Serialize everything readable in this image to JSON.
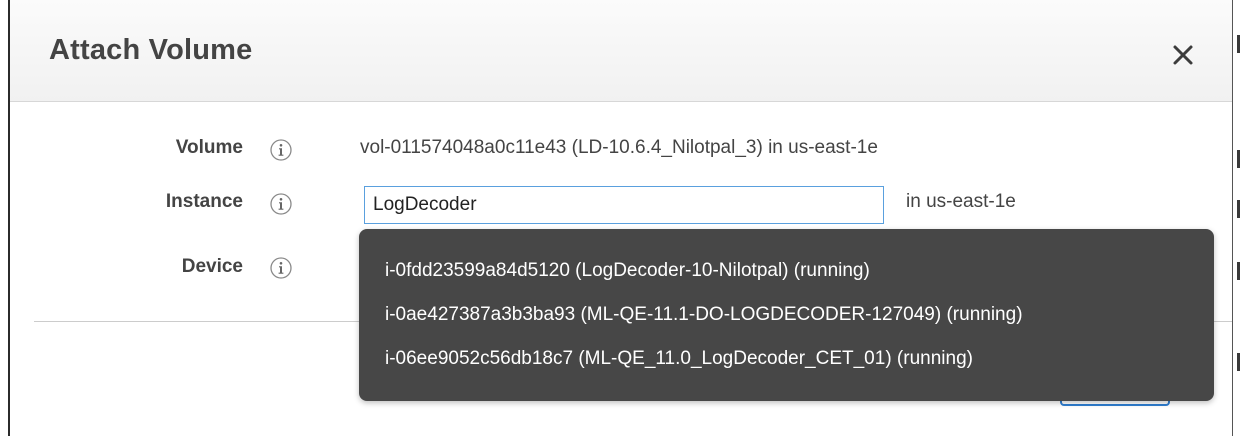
{
  "dialog": {
    "title": "Attach Volume",
    "close_icon": "close-icon"
  },
  "form": {
    "volume": {
      "label": "Volume",
      "info_icon": "info-icon",
      "value": "vol-011574048a0c11e43 (LD-10.6.4_Nilotpal_3) in us-east-1e"
    },
    "instance": {
      "label": "Instance",
      "info_icon": "info-icon",
      "value": "LogDecoder",
      "suffix": "in us-east-1e"
    },
    "device": {
      "label": "Device",
      "info_icon": "info-icon"
    }
  },
  "instance_suggestions": [
    "i-0fdd23599a84d5120 (LogDecoder-10-Nilotpal) (running)",
    "i-0ae427387a3b3ba93 (ML-QE-11.1-DO-LOGDECODER-127049) (running)",
    "i-06ee9052c56db18c7 (ML-QE_11.0_LogDecoder_CET_01) (running)"
  ],
  "colors": {
    "dropdown_background": "#474747",
    "input_focus_border": "#5aa0de",
    "primary_button_border": "#2f7ed1",
    "label_text": "#444444"
  }
}
